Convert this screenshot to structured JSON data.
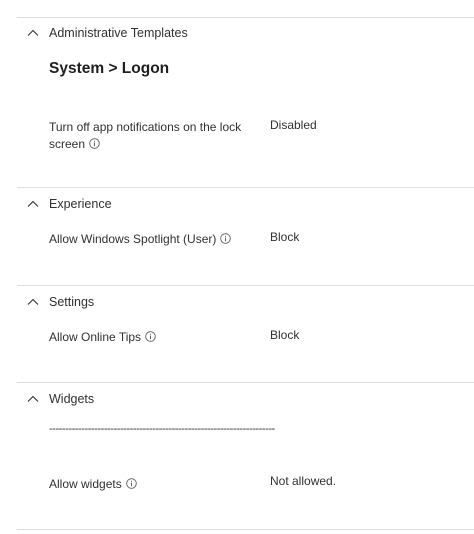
{
  "sections": [
    {
      "title": "Administrative Templates",
      "subheading": "System > Logon",
      "settings": [
        {
          "label_line1": "Turn off app notifications on the lock",
          "label_line2": "screen",
          "value": "Disabled"
        }
      ]
    },
    {
      "title": "Experience",
      "settings": [
        {
          "label": "Allow Windows Spotlight (User)",
          "value": "Block"
        }
      ]
    },
    {
      "title": "Settings",
      "settings": [
        {
          "label": "Allow Online Tips",
          "value": "Block"
        }
      ]
    },
    {
      "title": "Widgets",
      "separator": "----------------------------------------------------------------------",
      "settings": [
        {
          "label": "Allow widgets",
          "value": "Not allowed."
        }
      ]
    }
  ],
  "icons": {
    "collapse": "chevron-up-icon",
    "info": "info-icon"
  }
}
